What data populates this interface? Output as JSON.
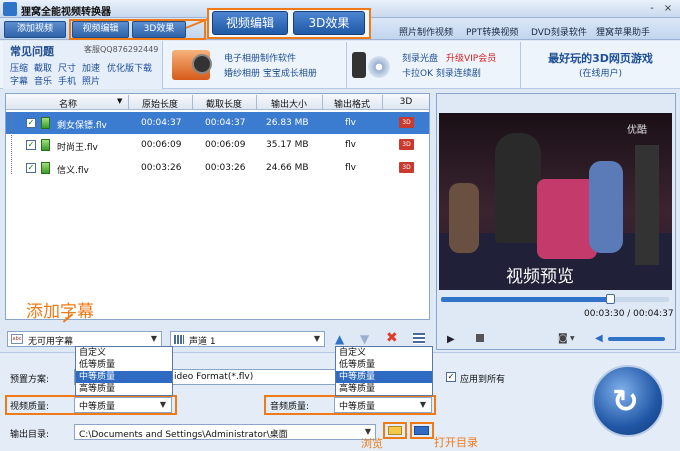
{
  "window": {
    "title": "狸窝全能视频转换器",
    "min": "-",
    "close": "×"
  },
  "toolbar": {
    "add_video": "添加视频",
    "edit_video": "视频编辑",
    "effect_3d": "3D效果",
    "big_edit_video": "视频编辑",
    "big_effect_3d": "3D效果",
    "links": [
      "照片制作视频",
      "PPT转换视频",
      "DVD刻录软件",
      "狸窝苹果助手"
    ]
  },
  "faq": {
    "title": "常见问题",
    "qq": "客服QQ876292449",
    "row1": [
      "压缩",
      "截取",
      "尺寸",
      "加速",
      "优化版下载"
    ],
    "row2": [
      "字幕",
      "音乐",
      "手机",
      "照片"
    ]
  },
  "promos": {
    "album_line1": "电子相册制作软件",
    "album_line2": "婚纱相册 宝宝成长相册",
    "burn_line1": "刻录光盘",
    "burn_vip": "升级VIP会员",
    "burn_line2": "卡拉OK 刻录连续剧",
    "game_title": "最好玩的3D网页游戏",
    "game_online": "(在线用户)"
  },
  "file_table": {
    "columns": [
      "名称",
      "原始长度",
      "截取长度",
      "输出大小",
      "输出格式",
      "3D"
    ],
    "rows": [
      {
        "name": "剩女保镖.flv",
        "orig": "00:04:37",
        "cut": "00:04:37",
        "size": "26.83 MB",
        "format": "flv",
        "check": "✓"
      },
      {
        "name": "时尚王.flv",
        "orig": "00:06:09",
        "cut": "00:06:09",
        "size": "35.17 MB",
        "format": "flv",
        "check": "✓"
      },
      {
        "name": "信义.flv",
        "orig": "00:03:26",
        "cut": "00:03:26",
        "size": "24.66 MB",
        "format": "flv",
        "check": "✓"
      }
    ],
    "badge_3d": "3D"
  },
  "preview": {
    "label": "视频预览",
    "logo": "优酷",
    "time": "00:03:30 / 00:04:37",
    "progress": 0.74
  },
  "subtitle": {
    "annotation": "添加字幕",
    "value": "无可用字幕",
    "audio_value": "声道 1"
  },
  "quality_options": [
    "自定义",
    "低等质量",
    "中等质量",
    "高等质量"
  ],
  "settings": {
    "preset_label": "预置方案:",
    "preset_value": "ideo Format(*.flv)",
    "apply_all": "应用到所有",
    "video_quality_label": "视频质量:",
    "video_quality_value": "中等质量",
    "audio_quality_label": "音频质量:",
    "audio_quality_value": "中等质量",
    "output_label": "输出目录:",
    "output_path": "C:\\Documents and Settings\\Administrator\\桌面",
    "browse_annot": "浏览",
    "open_annot": "打开目录"
  },
  "colors": {
    "accent": "#2f74c8",
    "annotation": "#f07a17",
    "selected": "#2f6bc2"
  }
}
